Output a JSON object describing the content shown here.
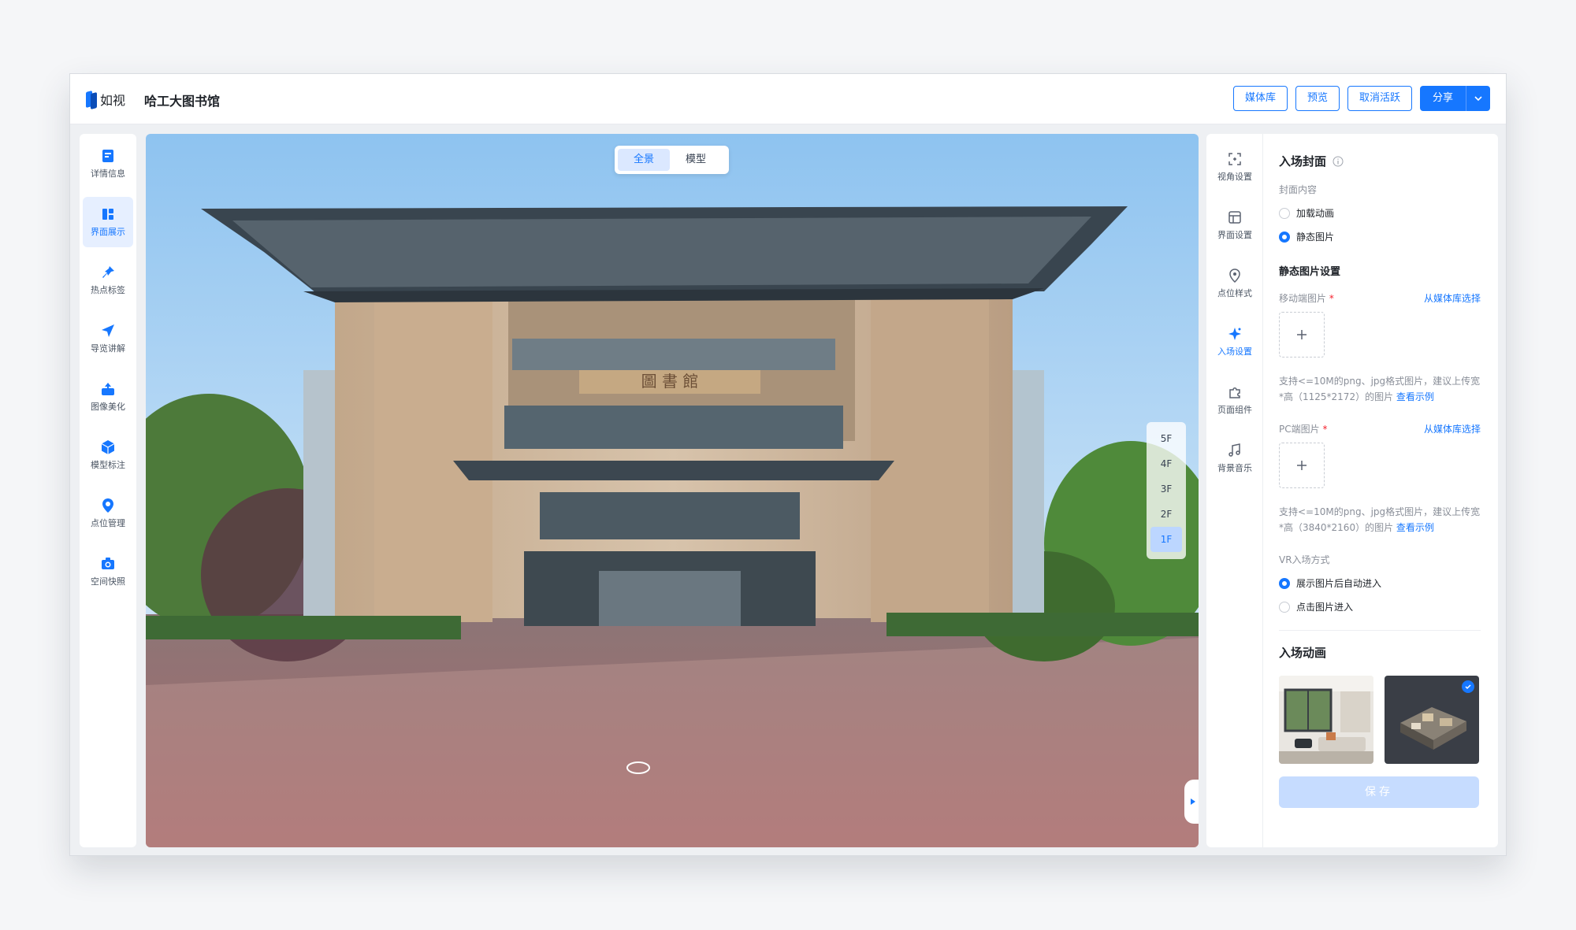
{
  "app": {
    "logo_text": "如视",
    "title": "哈工大图书馆"
  },
  "toolbar": {
    "media_label": "媒体库",
    "preview_label": "预览",
    "deactivate_label": "取消活跃",
    "share_label": "分享"
  },
  "left_nav": {
    "items": [
      {
        "label": "详情信息",
        "icon": "document-icon",
        "active": false
      },
      {
        "label": "界面展示",
        "icon": "layout-icon",
        "active": true
      },
      {
        "label": "热点标签",
        "icon": "pin-icon",
        "active": false
      },
      {
        "label": "导览讲解",
        "icon": "send-icon",
        "active": false
      },
      {
        "label": "图像美化",
        "icon": "image-enhance-icon",
        "active": false
      },
      {
        "label": "模型标注",
        "icon": "cube-icon",
        "active": false
      },
      {
        "label": "点位管理",
        "icon": "location-icon",
        "active": false
      },
      {
        "label": "空间快照",
        "icon": "camera-icon",
        "active": false
      }
    ]
  },
  "viewer": {
    "tabs": [
      {
        "label": "全景",
        "active": true
      },
      {
        "label": "模型",
        "active": false
      }
    ],
    "floors": [
      "5F",
      "4F",
      "3F",
      "2F",
      "1F"
    ],
    "active_floor": "1F",
    "signboard_text": "圖 書 館"
  },
  "right_tools": {
    "items": [
      {
        "label": "视角设置",
        "icon": "viewfinder-icon",
        "active": false
      },
      {
        "label": "界面设置",
        "icon": "interface-icon",
        "active": false
      },
      {
        "label": "点位样式",
        "icon": "map-pin-icon",
        "active": false
      },
      {
        "label": "入场设置",
        "icon": "sparkle-icon",
        "active": true
      },
      {
        "label": "页面组件",
        "icon": "puzzle-icon",
        "active": false
      },
      {
        "label": "背景音乐",
        "icon": "music-icon",
        "active": false
      }
    ]
  },
  "entry_cover": {
    "title": "入场封面",
    "content_label": "封面内容",
    "options": [
      {
        "label": "加载动画",
        "selected": false
      },
      {
        "label": "静态图片",
        "selected": true
      }
    ],
    "static_settings_title": "静态图片设置",
    "mobile_label": "移动端图片",
    "mobile_link": "从媒体库选择",
    "mobile_hint": "支持<=10M的png、jpg格式图片，建议上传宽*高（1125*2172）的图片",
    "mobile_example": "查看示例",
    "pc_label": "PC端图片",
    "pc_link": "从媒体库选择",
    "pc_hint": "支持<=10M的png、jpg格式图片，建议上传宽*高（3840*2160）的图片",
    "pc_example": "查看示例",
    "vr_label": "VR入场方式",
    "vr_options": [
      {
        "label": "展示图片后自动进入",
        "selected": true
      },
      {
        "label": "点击图片进入",
        "selected": false
      }
    ]
  },
  "entry_animation": {
    "title": "入场动画",
    "selected_index": 1
  },
  "save_label": "保存",
  "colors": {
    "accent": "#1677ff",
    "accent_light": "#e6efff",
    "save_disabled": "#c6dcff"
  }
}
